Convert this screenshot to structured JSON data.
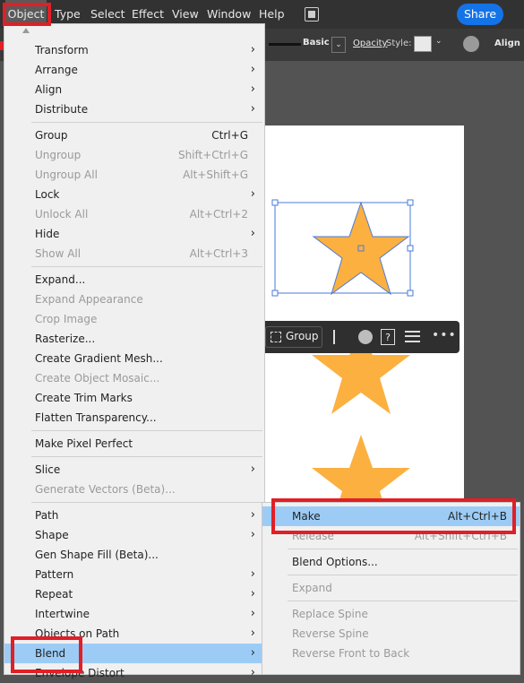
{
  "menubar": {
    "items": [
      "Object",
      "Type",
      "Select",
      "Effect",
      "View",
      "Window",
      "Help"
    ],
    "share_label": "Share"
  },
  "controlbar": {
    "stroke_preset": "Basic",
    "opacity_label": "Opacity",
    "style_label": "Style:",
    "align_label": "Align"
  },
  "context_toolbar": {
    "group_label": "Group",
    "help_label": "?"
  },
  "object_menu": {
    "transform": "Transform",
    "arrange": "Arrange",
    "align": "Align",
    "distribute": "Distribute",
    "group": "Group",
    "group_sc": "Ctrl+G",
    "ungroup": "Ungroup",
    "ungroup_sc": "Shift+Ctrl+G",
    "ungroup_all": "Ungroup All",
    "ungroup_all_sc": "Alt+Shift+G",
    "lock": "Lock",
    "unlock_all": "Unlock All",
    "unlock_all_sc": "Alt+Ctrl+2",
    "hide": "Hide",
    "show_all": "Show All",
    "show_all_sc": "Alt+Ctrl+3",
    "expand": "Expand...",
    "expand_appearance": "Expand Appearance",
    "crop_image": "Crop Image",
    "rasterize": "Rasterize...",
    "gradient_mesh": "Create Gradient Mesh...",
    "object_mosaic": "Create Object Mosaic...",
    "trim_marks": "Create Trim Marks",
    "flatten_transparency": "Flatten Transparency...",
    "pixel_perfect": "Make Pixel Perfect",
    "slice": "Slice",
    "generate_vectors": "Generate Vectors (Beta)...",
    "path": "Path",
    "shape": "Shape",
    "gen_shape_fill": "Gen Shape Fill (Beta)...",
    "pattern": "Pattern",
    "repeat": "Repeat",
    "intertwine": "Intertwine",
    "objects_on_path": "Objects on Path",
    "blend": "Blend",
    "envelope_distort": "Envelope Distort"
  },
  "blend_submenu": {
    "make": "Make",
    "make_sc": "Alt+Ctrl+B",
    "release": "Release",
    "release_sc": "Alt+Shift+Ctrl+B",
    "blend_options": "Blend Options...",
    "expand": "Expand",
    "replace_spine": "Replace Spine",
    "reverse_spine": "Reverse Spine",
    "reverse_front_to_back": "Reverse Front to Back"
  },
  "colors": {
    "star_fill": "#fbb040",
    "selection": "#4a7bd8",
    "highlight": "#9cccf5",
    "annotation_red": "#e01f26",
    "share_blue": "#1473e6"
  }
}
